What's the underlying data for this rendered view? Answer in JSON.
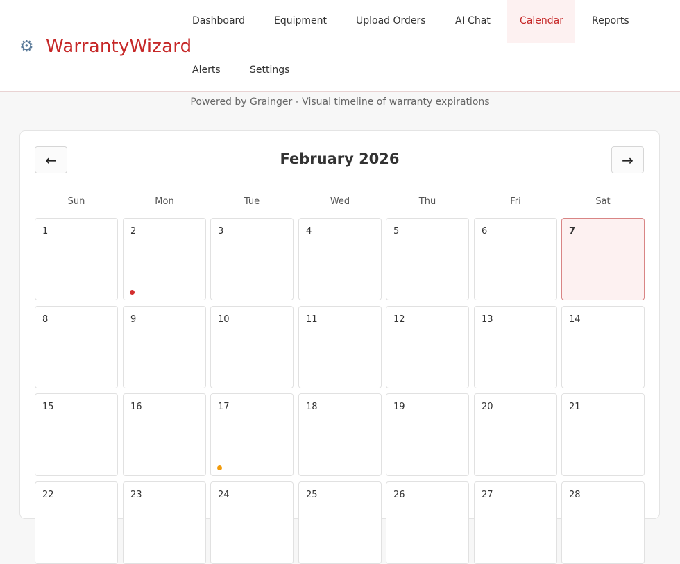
{
  "brand": {
    "icon": "gear-icon",
    "name": "WarrantyWizard"
  },
  "nav": [
    {
      "label": "Dashboard",
      "active": false
    },
    {
      "label": "Equipment",
      "active": false
    },
    {
      "label": "Upload Orders",
      "active": false
    },
    {
      "label": "AI Chat",
      "active": false
    },
    {
      "label": "Calendar",
      "active": true
    },
    {
      "label": "Reports",
      "active": false
    },
    {
      "label": "Alerts",
      "active": false
    },
    {
      "label": "Settings",
      "active": false
    }
  ],
  "subtitle": "Powered by Grainger - Visual timeline of warranty expirations",
  "calendar": {
    "prev_icon": "←",
    "next_icon": "→",
    "month_title": "February 2026",
    "weekdays": [
      "Sun",
      "Mon",
      "Tue",
      "Wed",
      "Thu",
      "Fri",
      "Sat"
    ],
    "weeks": [
      [
        "1",
        "2",
        "3",
        "4",
        "5",
        "6",
        "7"
      ],
      [
        "8",
        "9",
        "10",
        "11",
        "12",
        "13",
        "14"
      ],
      [
        "15",
        "16",
        "17",
        "18",
        "19",
        "20",
        "21"
      ],
      [
        "22",
        "23",
        "24",
        "25",
        "26",
        "27",
        "28"
      ]
    ],
    "today": "7",
    "markers": [
      {
        "day": "2",
        "color": "#d32f2f"
      },
      {
        "day": "17",
        "color": "#f29b0c"
      }
    ]
  },
  "colors": {
    "brand": "#c62828",
    "today_bg": "#fdf1f1",
    "today_border": "#d98585"
  }
}
